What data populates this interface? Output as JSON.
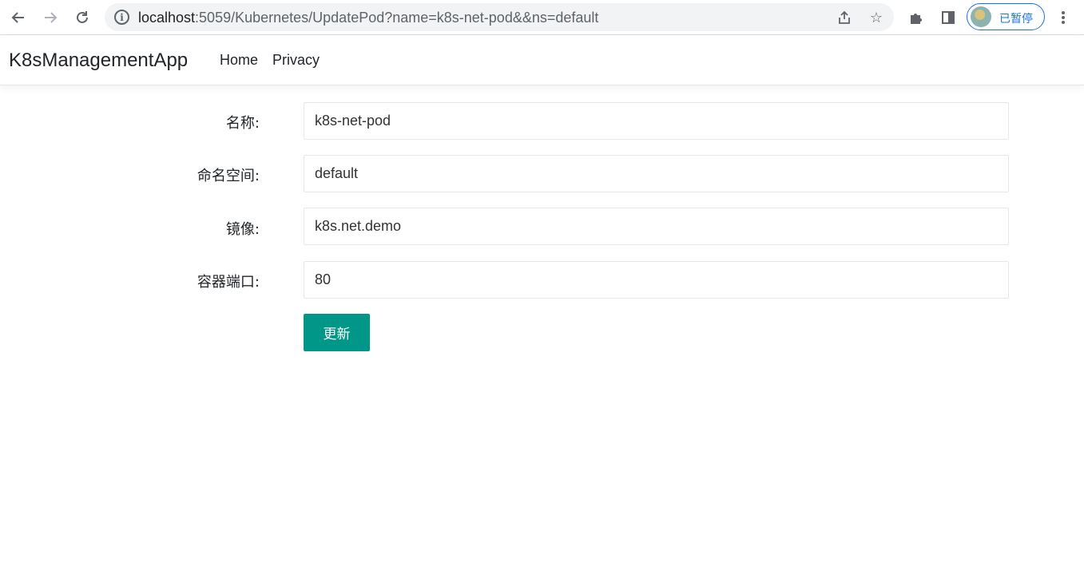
{
  "browser": {
    "url_host": "localhost",
    "url_rest": ":5059/Kubernetes/UpdatePod?name=k8s-net-pod&&ns=default",
    "profile_label": "已暂停",
    "icons": [
      "back-icon",
      "forward-icon",
      "reload-icon",
      "site-info-icon",
      "share-icon",
      "star-icon",
      "extensions-icon",
      "side-panel-icon",
      "menu-icon"
    ]
  },
  "navbar": {
    "brand": "K8sManagementApp",
    "links": [
      "Home",
      "Privacy"
    ]
  },
  "form": {
    "fields": [
      {
        "label": "名称:",
        "value": "k8s-net-pod"
      },
      {
        "label": "命名空间:",
        "value": "default"
      },
      {
        "label": "镜像:",
        "value": "k8s.net.demo"
      },
      {
        "label": "容器端口:",
        "value": "80"
      }
    ],
    "submit_label": "更新",
    "accent_color": "#009688"
  }
}
